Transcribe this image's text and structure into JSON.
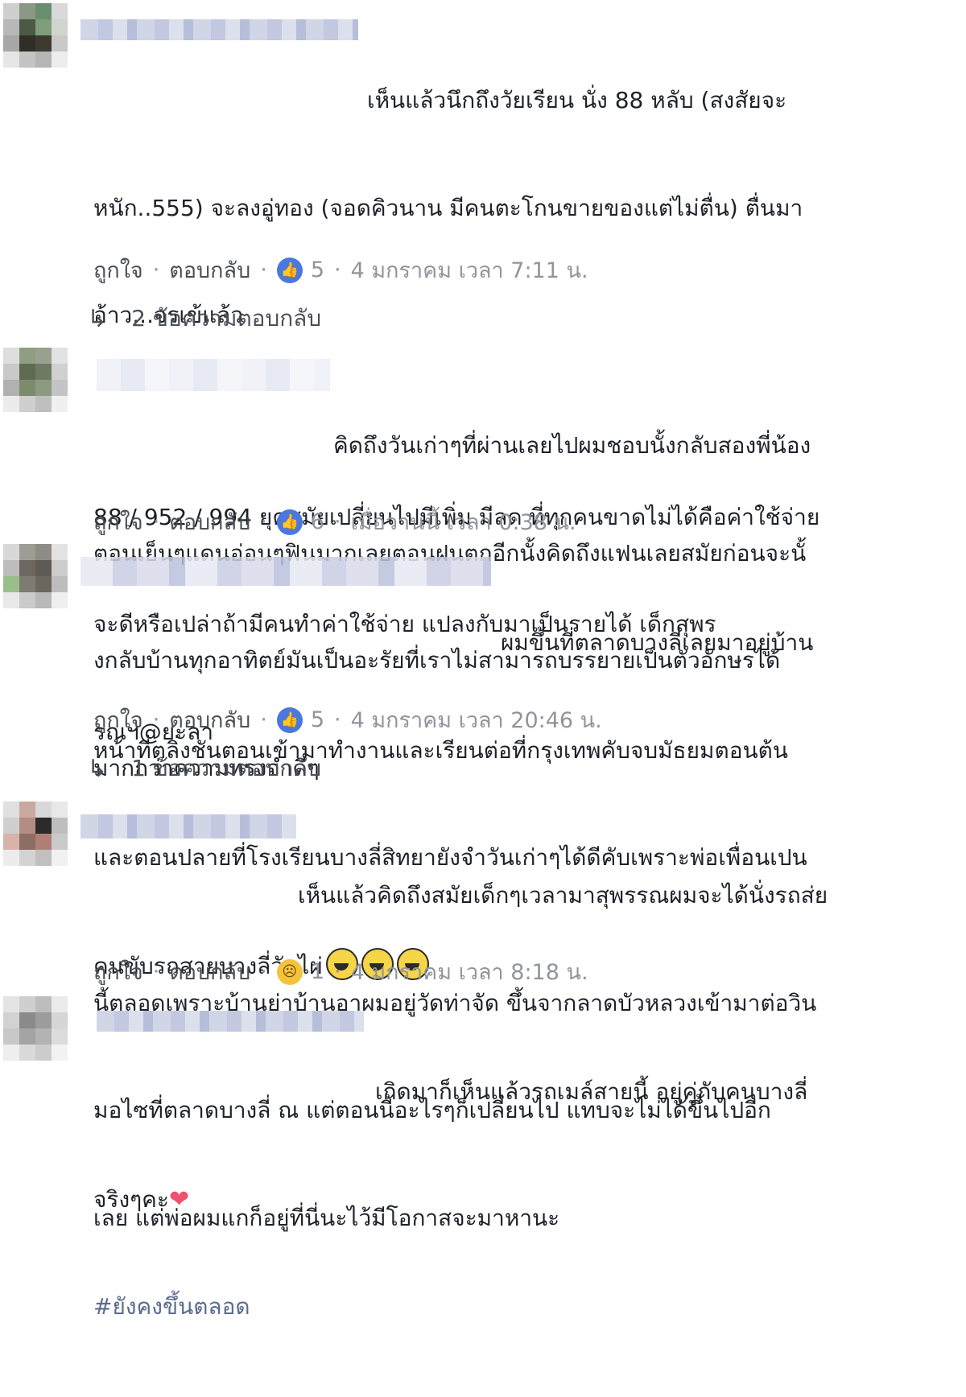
{
  "actions": {
    "like": "ถูกใจ",
    "reply": "ตอบกลับ",
    "separator": "·"
  },
  "colors": {
    "reaction_like": "#4a78e0",
    "reaction_sad": "#f5c33b",
    "meta_text": "#90949c"
  },
  "comments": [
    {
      "text_lines": [
        "เห็นแล้วนึกถึงวัยเรียน นั่ง 88 หลับ (สงสัยจะ",
        "หนัก..555) จะลงอู่ทอง (จอดคิวนาน มีคนตะโกนขายของแต่ไม่ตื่น) ตื่นมา",
        "อ้าว...จรเข้แล้ว",
        "",
        "88 / 952 / 994 ยุคสมัยเปลี่ยนไปมีเพิ่ม มีลด ที่ทุกคนขาดไม่ได้คือค่าใช้จ่าย",
        "จะดีหรือเปล่าถ้ามีคนทำค่าใช้จ่าย แปลงกับมาเป็นรายได้ เด็กสุพร",
        "รณฯ@ยะลา"
      ],
      "reaction_icon": "like-icon",
      "reaction_count": "5",
      "time": "4 มกราคม เวลา 7:11 น.",
      "replies": "2 ข้อความตอบกลับ"
    },
    {
      "text_lines": [
        "คิดถึงวันเก่าๆที่ผ่านเลยไปผมชอบนั้งกลับสองพี่น้อง",
        "ตอนเย็นๆแดนอ่อนๆฟินมากเลยตอนฝนตกอีกนั้งคิดถึงแฟนเลยสมัยก่อนจะนั้",
        "งกลับบ้านทุกอาทิตย์มันเป็นอะรัยที่เราไม่สามารถบรรยายเป็นตัวอักษรได้",
        "มากกว่าความทรงจำดีๆ"
      ],
      "reaction_icon": "like-icon",
      "reaction_count": "6",
      "time": "เมื่อวานนี้ เวลา 0:38 น."
    },
    {
      "text_lines": [
        "ผมขึ้นที่ตลาดบางลี่เลยมาอยู่บ้าน",
        "หน้าที่ตลิ่งชันตอนเข้ามาทำงานและเรียนต่อที่กรุงเทพคับจบมัธยมตอนต้น",
        "และตอนปลายที่โรงเรียนบางลี่สิทยายังจำวันเก่าๆได้ดีคับเพราะพ่อเพื่อนเปน",
        "คนขับรถสายบางลี่วัดไผ่"
      ],
      "reaction_icon": "like-icon",
      "reaction_count": "5",
      "time": "4 มกราคม เวลา 20:46 น.",
      "replies": "1 ข้อความตอบกลับ"
    },
    {
      "text_lines": [
        "เห็นแล้วคิดถึงสมัยเด็กๆเวลามาสุพรรณผมจะได้นั่งรถส่ย",
        "นี้ตลอดเพราะบ้านย่าบ้านอาผมอยู่วัดท่าจัด ขึ้นจากลาดบัวหลวงเข้ามาต่อวิน",
        "มอไซที่ตลาดบางลี่ ณ แต่ตอนนี้อะไรๆก็เปลี่ยนไป แทบจะไม่ได้ขึ้นไปอีก",
        "เลย แต่พ่อผมแกก็อยู่ที่นี่นะไว้มีโอกาสจะมาหานะ"
      ],
      "reaction_icon": "sad-face-icon",
      "reaction_count": "1",
      "time": "4 มกราคม เวลา 8:18 น."
    },
    {
      "text_lines": [
        "เกิดมาก็เห็นแล้วรถเมล์สายนี้ อยู่คู่กับคนบางลี่",
        "จริงๆคะ"
      ],
      "hashtag": "#ยังคงขึ้นตลอด"
    }
  ]
}
